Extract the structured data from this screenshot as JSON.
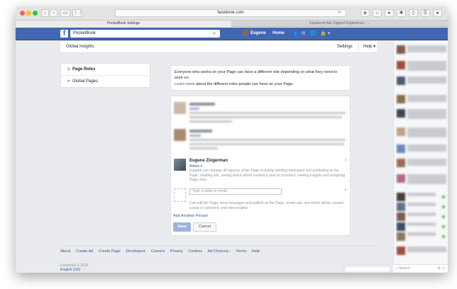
{
  "browser": {
    "url": "facebook.com",
    "tabs": [
      {
        "label": "PocketBook Settings",
        "active": true
      },
      {
        "label": "Facebook Ads Support Experience - ...",
        "active": false
      }
    ],
    "toolbar_icons": [
      "back-icon",
      "forward-icon",
      "sidebar-icon",
      "tabs-grid-icon",
      "reload-icon",
      "shield-icon",
      "home-icon",
      "extension-icon",
      "share-icon",
      "newtab-icon"
    ]
  },
  "fbbar": {
    "logo": "f",
    "search_value": "PocketBook",
    "user_name": "Eugene",
    "home_label": "Home"
  },
  "subnav": {
    "title": "Global Insights",
    "settings": "Settings",
    "help": "Help ▾"
  },
  "leftnav": {
    "items": [
      {
        "label": "Page Roles",
        "icon": "person-icon"
      },
      {
        "label": "Global Pages",
        "icon": "star-icon"
      }
    ]
  },
  "info": {
    "text": "Everyone who works on your Page can have a different role depending on what they need to work on.",
    "link": "Learn more",
    "link_suffix": " about the different roles people can have on your Page."
  },
  "members": [
    {
      "name": "Eugene Zingerman",
      "role": "Admin ▾",
      "description": "Eugene can manage all aspects of the Page including sending messages and publishing as the Page, creating ads, seeing which admin created a post or comment, viewing insights and assigning Page roles."
    }
  ],
  "add_person": {
    "placeholder": "Type a name or email...",
    "description": "Can edit the Page, send messages and publish as the Page, create ads, see which admin created a post or comment, and view insights.",
    "add_another": "Add Another Person",
    "save": "Save",
    "cancel": "Cancel"
  },
  "footer": {
    "links": [
      "About",
      "Create Ad",
      "Create Page",
      "Developers",
      "Careers",
      "Privacy",
      "Cookies",
      "Ad Choices▷",
      "Terms",
      "Help"
    ],
    "copyright": "Facebook © 2015",
    "language": "English (US)"
  },
  "chat": {
    "search_placeholder": "Search"
  },
  "colors": {
    "fb_blue": "#4267b2",
    "link": "#385898",
    "save_disabled": "#9cb4d8",
    "online": "#42b72a"
  }
}
